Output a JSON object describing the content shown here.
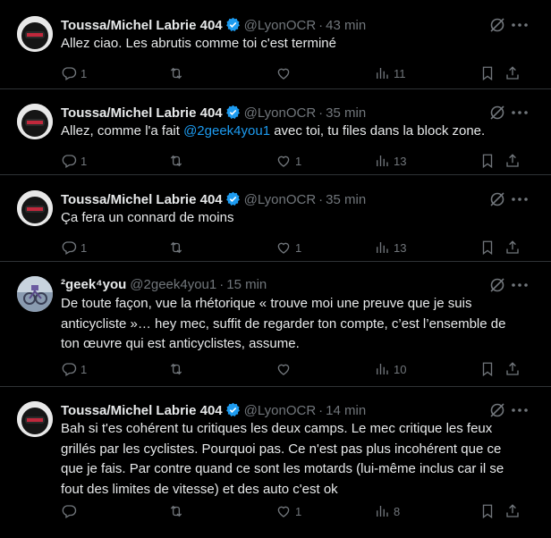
{
  "tweets": [
    {
      "author": "Toussa/Michel Labrie 404",
      "handle": "@LyonOCR",
      "time": "43 min",
      "text": "Allez ciao. Les abrutis comme toi c'est terminé",
      "replies": "1",
      "retweets": "",
      "likes": "",
      "views": "11"
    },
    {
      "author": "Toussa/Michel Labrie 404",
      "handle": "@LyonOCR",
      "time": "35 min",
      "text_before": "Allez, comme l'a fait ",
      "mention": "@2geek4you1",
      "text_after": " avec toi, tu files dans la block zone.",
      "replies": "1",
      "retweets": "",
      "likes": "1",
      "views": "13"
    },
    {
      "author": "Toussa/Michel Labrie 404",
      "handle": "@LyonOCR",
      "time": "35 min",
      "text": "Ça fera un connard de moins",
      "replies": "1",
      "retweets": "",
      "likes": "1",
      "views": "13"
    },
    {
      "author": "²geek⁴you",
      "handle": "@2geek4you1",
      "time": "15 min",
      "text": "De toute façon, vue la rhétorique « trouve moi une preuve que je suis anticycliste »… hey mec, suffit de regarder ton compte, c’est l’ensemble de ton œuvre qui est anticyclistes, assume.",
      "replies": "1",
      "retweets": "",
      "likes": "",
      "views": "10"
    },
    {
      "author": "Toussa/Michel Labrie 404",
      "handle": "@LyonOCR",
      "time": "14 min",
      "text": "Bah si t'es cohérent tu critiques les deux camps. Le mec critique les feux grillés par les cyclistes. Pourquoi pas. Ce n'est pas plus incohérent que ce que je fais. Par contre quand ce sont les motards (lui-même inclus car il se fout des limites de vitesse) et des auto c'est ok",
      "replies": "",
      "retweets": "",
      "likes": "1",
      "views": "8"
    }
  ],
  "ui": {
    "separator": "·",
    "icons": [
      "reply-icon",
      "retweet-icon",
      "like-icon",
      "views-icon",
      "bookmark-icon",
      "share-icon",
      "grok-icon",
      "more-icon",
      "verified-badge-icon"
    ],
    "colors": {
      "background": "#000000",
      "text": "#e7e9ea",
      "muted": "#71767b",
      "link": "#1d9bf0",
      "border": "#2f3336"
    }
  }
}
